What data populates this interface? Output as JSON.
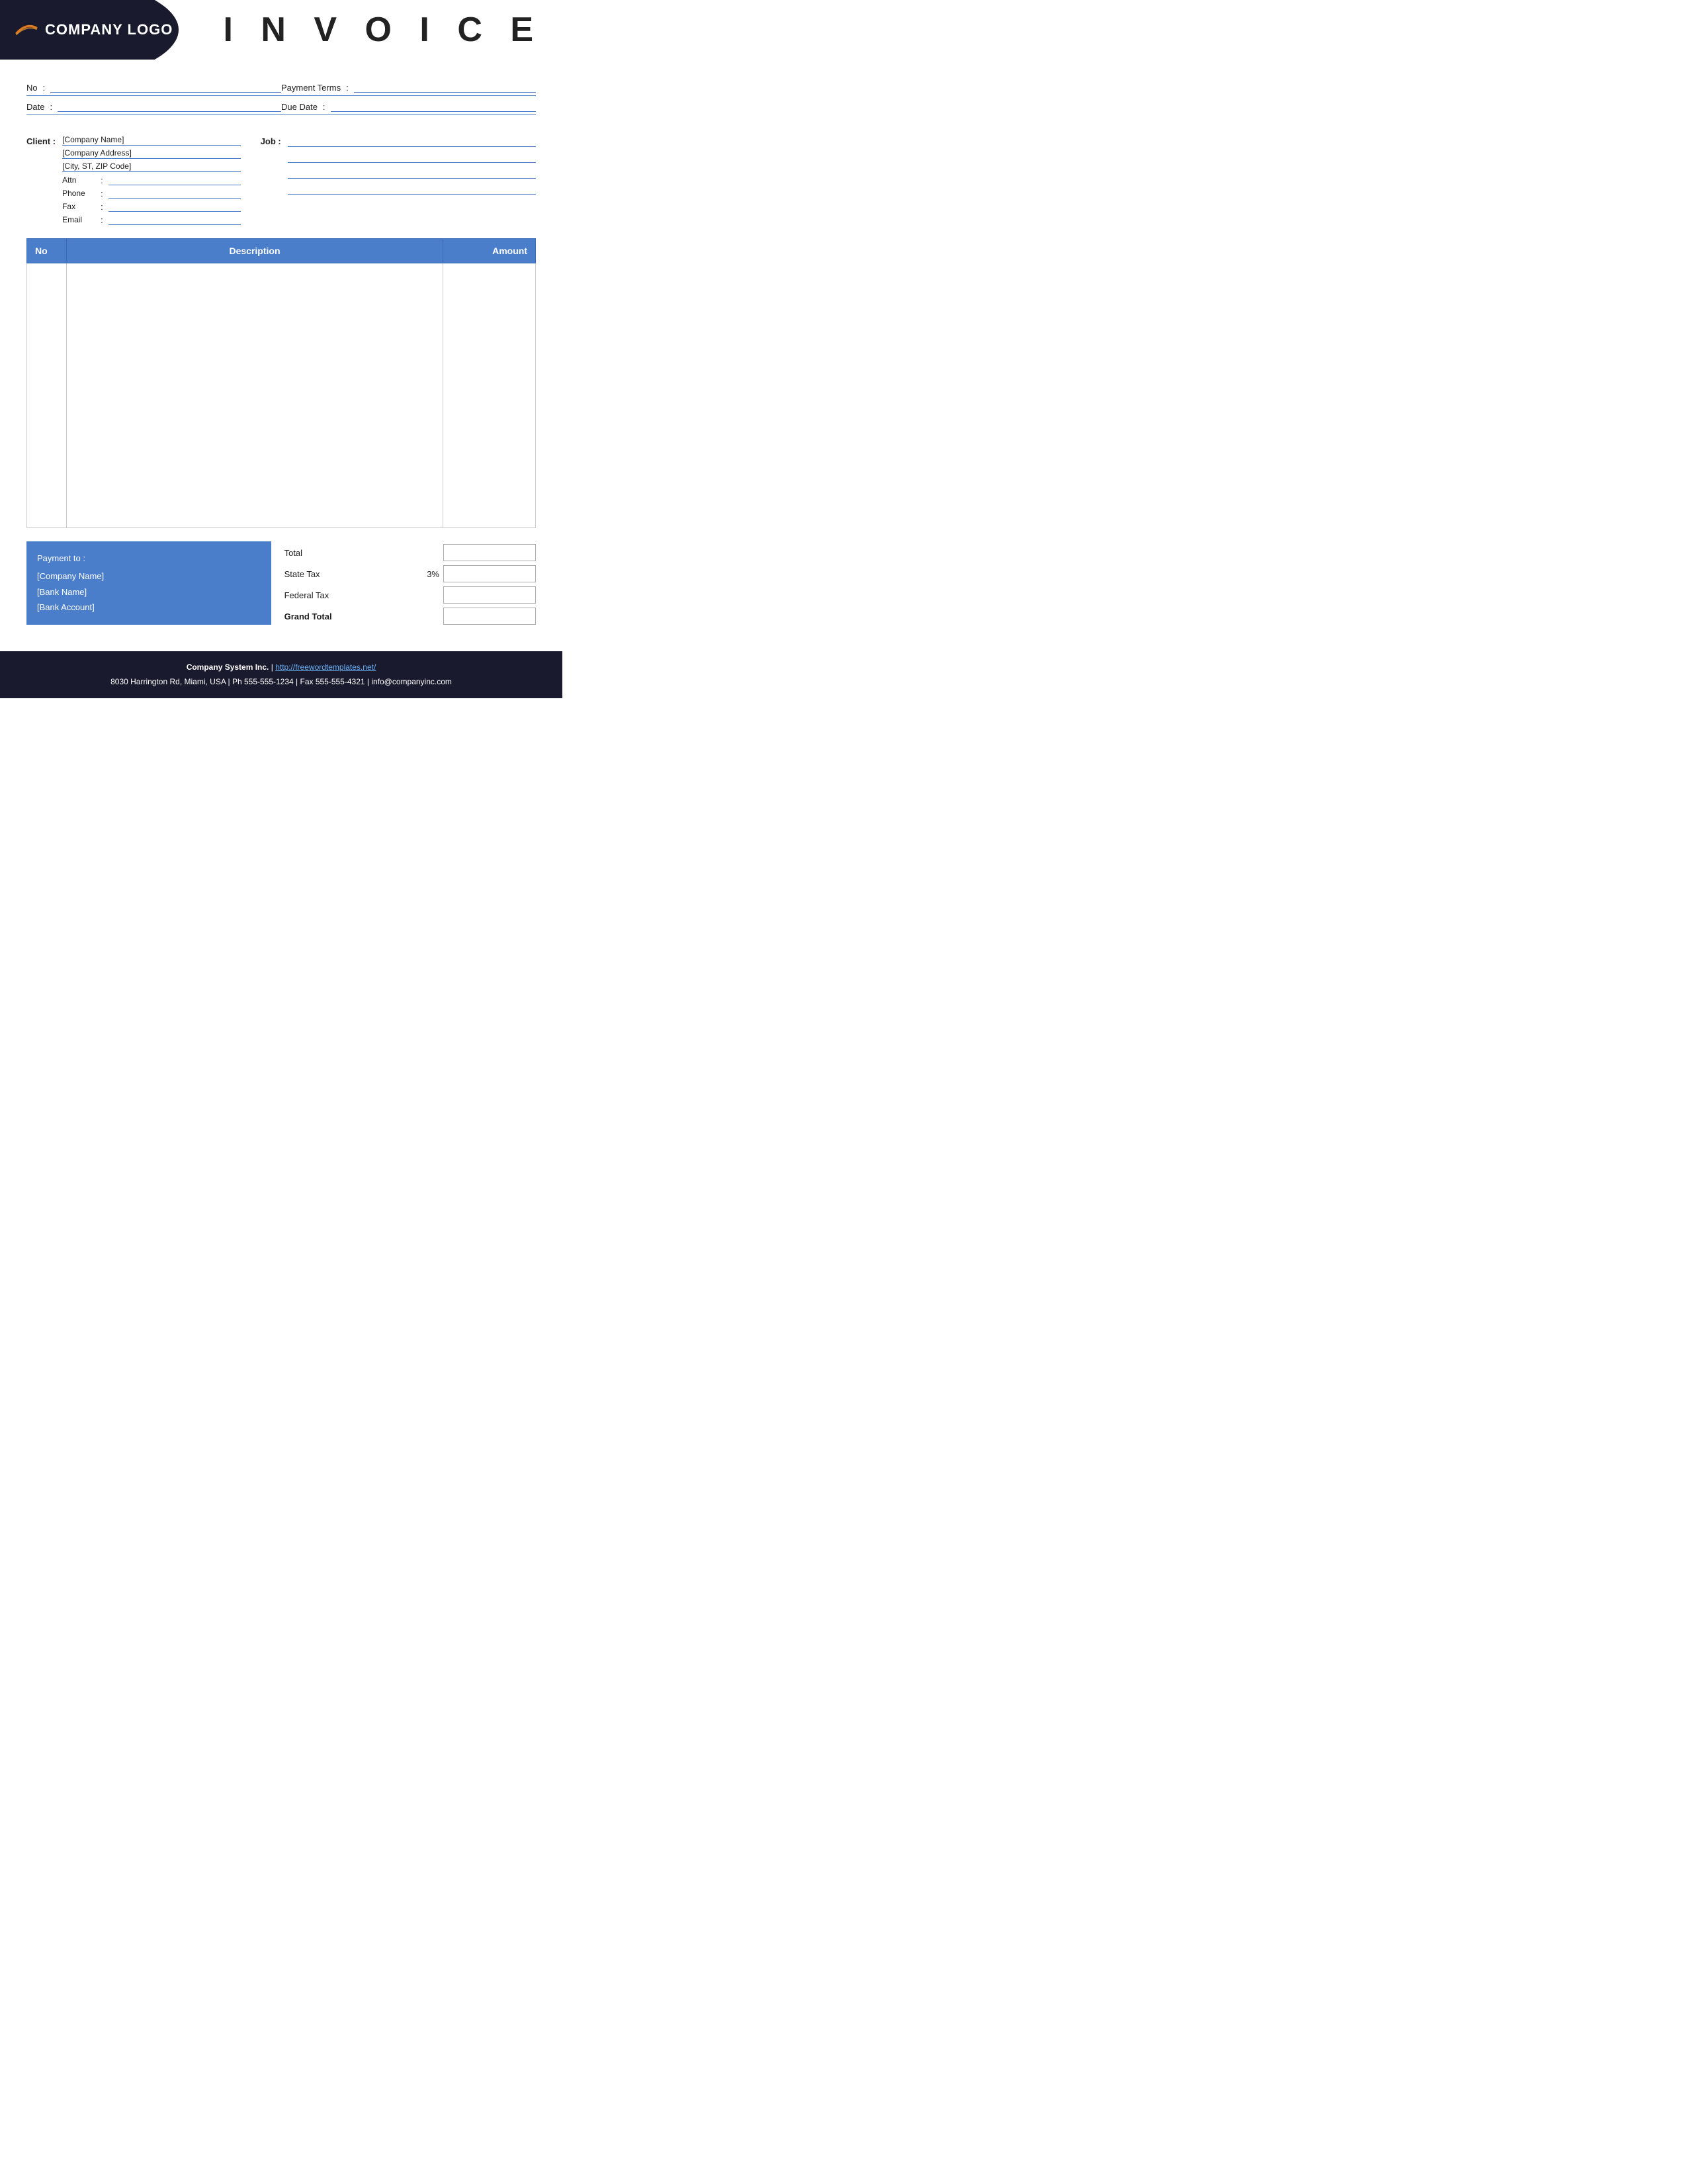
{
  "header": {
    "logo_text": "COMPANY LOGO",
    "invoice_title": "I N V O I C E"
  },
  "info": {
    "no_label": "No",
    "no_value": "",
    "payment_terms_label": "Payment  Terms",
    "payment_terms_value": "",
    "date_label": "Date",
    "date_value": "",
    "due_date_label": "Due Date",
    "due_date_value": ""
  },
  "client": {
    "label": "Client :",
    "company_name": "[Company Name]",
    "company_address": "[Company Address]",
    "city_zip": "[City, ST, ZIP Code]",
    "attn_label": "Attn",
    "attn_value": "",
    "phone_label": "Phone",
    "phone_value": "",
    "fax_label": "Fax",
    "fax_value": "",
    "email_label": "Email",
    "email_value": ""
  },
  "job": {
    "label": "Job :",
    "lines": [
      "",
      "",
      "",
      ""
    ]
  },
  "table": {
    "col_no": "No",
    "col_description": "Description",
    "col_amount": "Amount"
  },
  "payment": {
    "title": "Payment to :",
    "company_name": "[Company Name]",
    "bank_name": "[Bank Name]",
    "bank_account": "[Bank Account]"
  },
  "totals": {
    "total_label": "Total",
    "state_tax_label": "State Tax",
    "state_tax_percent": "3%",
    "federal_tax_label": "Federal Tax",
    "grand_total_label": "Grand Total",
    "total_value": "",
    "state_tax_value": "",
    "federal_tax_value": "",
    "grand_total_value": ""
  },
  "footer": {
    "company": "Company System Inc.",
    "separator": "|",
    "website": "http://freewordtemplates.net/",
    "address": "8030 Harrington Rd, Miami, USA | Ph 555-555-1234 | Fax 555-555-4321 | info@companyinc.com"
  }
}
